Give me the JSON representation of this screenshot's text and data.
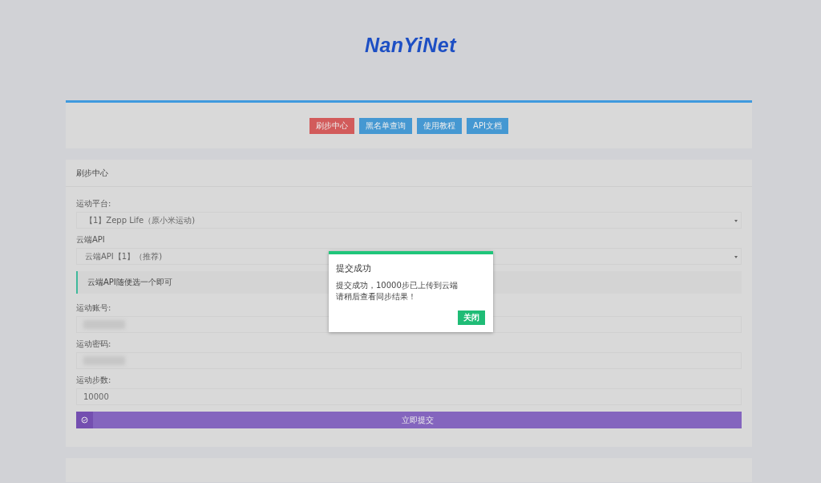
{
  "logo": {
    "text": "NanYiNet"
  },
  "nav": [
    {
      "label": "刷步中心",
      "selected": true
    },
    {
      "label": "黑名单查询",
      "selected": false
    },
    {
      "label": "使用教程",
      "selected": false
    },
    {
      "label": "API文档",
      "selected": false
    }
  ],
  "form": {
    "title": "刷步中心",
    "fields": [
      {
        "kind": "select",
        "label": "运动平台:",
        "value": "【1】Zepp Life（原小米运动)"
      },
      {
        "kind": "select",
        "label": "云端API",
        "value": "云端API【1】（推荐)"
      },
      {
        "kind": "note",
        "text": "云端API随便选一个即可"
      },
      {
        "kind": "blurred",
        "label": "运动账号:"
      },
      {
        "kind": "blurred",
        "label": "运动密码:"
      },
      {
        "kind": "input",
        "label": "运动步数:",
        "value": "10000"
      }
    ],
    "submit": "立即提交"
  },
  "dialog": {
    "title": "提交成功",
    "lines": [
      "提交成功，10000步已上传到云端",
      "请稍后查看同步结果！"
    ],
    "button": "关闭"
  }
}
